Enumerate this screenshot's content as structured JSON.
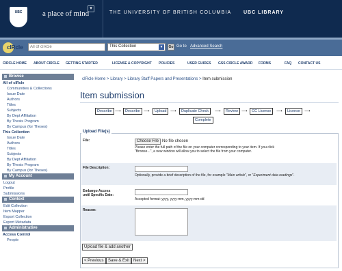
{
  "header": {
    "logo_text": "UBC",
    "tagline": "a place of mind",
    "university": "THE UNIVERSITY OF BRITISH COLUMBIA",
    "library": "UBC LIBRARY"
  },
  "search": {
    "logo_text": "cIRcle",
    "placeholder": "All of cIRcle",
    "scope": "This Collection",
    "go_button": "Go",
    "go_label": "Go to",
    "advanced_link": "Advanced Search"
  },
  "nav": [
    "CIRCLE HOME",
    "ABOUT CIRCLE",
    "GETTING STARTED",
    "LICENSE & COPYRIGHT",
    "POLICIES",
    "USER GUIDES",
    "GSS CIRCLE AWARD",
    "FORMS",
    "FAQ",
    "CONTACT US"
  ],
  "sidebar": {
    "browse": "Browse",
    "all_heading": "All of cIRcle",
    "all_items": [
      "Communities & Collections",
      "Issue Date",
      "Authors",
      "Titles",
      "Subjects",
      "By Dept Affiliation",
      "By Thesis Program",
      "By Campus (for Theses)"
    ],
    "this_heading": "This Collection",
    "this_items": [
      "Issue Date",
      "Authors",
      "Titles",
      "Subjects",
      "By Dept Affiliation",
      "By Thesis Program",
      "By Campus (for Theses)"
    ],
    "account": "My Account",
    "account_items": [
      "Logout",
      "Profile",
      "Submissions"
    ],
    "context": "Context",
    "context_items": [
      "Edit Collection",
      "Item Mapper",
      "Export Collection",
      "Export Metadata"
    ],
    "admin": "Administrative",
    "admin_sub": "Access Control",
    "admin_items": [
      "People"
    ]
  },
  "breadcrumb": {
    "home": "cIRcle Home",
    "library": "Library",
    "collection": "Library Staff Papers and Presentations",
    "current": "Item submission"
  },
  "main": {
    "title": "Item submission",
    "steps": [
      "Describe",
      "Describe",
      "Upload",
      "Duplicate Check",
      "Review",
      "CC License",
      "License",
      "Complete"
    ],
    "legend": "Upload File(s)",
    "file_label": "File:",
    "file_button": "Choose File",
    "file_none": "No file chosen",
    "file_help": "Please enter the full path of the file on your computer corresponding to your item. If you click \"Browse...\", a new window will allow you to select the file from your computer.",
    "desc_label": "File Description:",
    "desc_help_1": "Optionally, provide a brief description of the file, for example \"",
    "desc_help_e1": "Main article",
    "desc_help_2": "\", or \"",
    "desc_help_e2": "Experiment data readings",
    "desc_help_3": "\".",
    "embargo_label_1": "Embargo Access",
    "embargo_label_2": "until Specific Date:",
    "embargo_help": "Accepted format: yyyy, yyyy-mm, yyyy-mm-dd",
    "reason_label": "Reason:",
    "upload_another": "Upload file & add another",
    "prev": "< Previous",
    "save_exit": "Save & Exit",
    "next": "Next >"
  }
}
